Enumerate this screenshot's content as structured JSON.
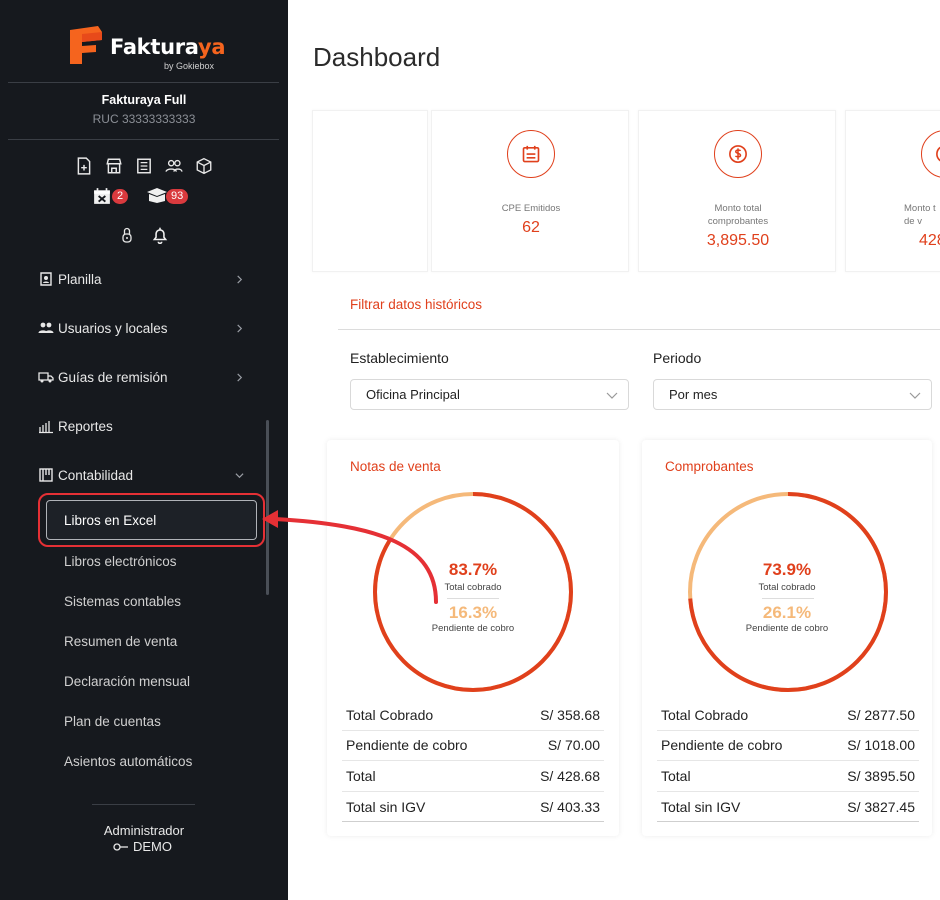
{
  "brand": {
    "name_main": "Faktura",
    "name_accent": "ya",
    "sub": "by Gokiebox"
  },
  "company": {
    "name": "Fakturaya Full",
    "ruc": "RUC 33333333333"
  },
  "toolbar": {
    "icons": [
      "file-plus-icon",
      "store-icon",
      "receipt-icon",
      "users-icon",
      "box-icon"
    ],
    "calendar_badge": "2",
    "box_badge": "93"
  },
  "menu": [
    {
      "label": "Planilla",
      "icon": "badge-icon"
    },
    {
      "label": "Usuarios y locales",
      "icon": "users-icon"
    },
    {
      "label": "Guías de remisión",
      "icon": "truck-icon"
    },
    {
      "label": "Reportes",
      "icon": "bar-chart-icon"
    },
    {
      "label": "Contabilidad",
      "icon": "ledger-icon"
    }
  ],
  "submenu": [
    "Libros en Excel",
    "Libros electrónicos",
    "Sistemas contables",
    "Resumen de venta",
    "Declaración mensual",
    "Plan de cuentas",
    "Asientos automáticos"
  ],
  "user": {
    "role": "Administrador",
    "name": "DEMO"
  },
  "page": {
    "title": "Dashboard"
  },
  "stats": [
    {
      "label": "CPE Emitidos",
      "value": "62",
      "icon": "calendar-icon"
    },
    {
      "label": "Monto total comprobantes",
      "value": "3,895.50",
      "icon": "dollar-icon"
    },
    {
      "label": "Monto t de v",
      "value": "428",
      "icon": "dollar-icon"
    }
  ],
  "filter": {
    "title": "Filtrar datos históricos",
    "establishment_label": "Establecimiento",
    "establishment_value": "Oficina Principal",
    "period_label": "Periodo",
    "period_value": "Por mes"
  },
  "cards": [
    {
      "title": "Notas de venta",
      "collected_pct": "83.7%",
      "collected_label": "Total cobrado",
      "pending_pct": "16.3%",
      "pending_label": "Pendiente de cobro",
      "collected_fraction": 0.837,
      "rows": [
        {
          "label": "Total Cobrado",
          "value": "S/ 358.68"
        },
        {
          "label": "Pendiente de cobro",
          "value": "S/ 70.00"
        },
        {
          "label": "Total",
          "value": "S/ 428.68"
        },
        {
          "label": "Total sin IGV",
          "value": "S/ 403.33"
        }
      ]
    },
    {
      "title": "Comprobantes",
      "collected_pct": "73.9%",
      "collected_label": "Total cobrado",
      "pending_pct": "26.1%",
      "pending_label": "Pendiente de cobro",
      "collected_fraction": 0.739,
      "rows": [
        {
          "label": "Total Cobrado",
          "value": "S/ 2877.50"
        },
        {
          "label": "Pendiente de cobro",
          "value": "S/ 1018.00"
        },
        {
          "label": "Total",
          "value": "S/ 3895.50"
        },
        {
          "label": "Total sin IGV",
          "value": "S/ 3827.45"
        }
      ]
    }
  ],
  "colors": {
    "accent": "#e0401c",
    "pending": "#f5b97a",
    "sidebar": "#16191e",
    "highlight": "#e53035"
  }
}
